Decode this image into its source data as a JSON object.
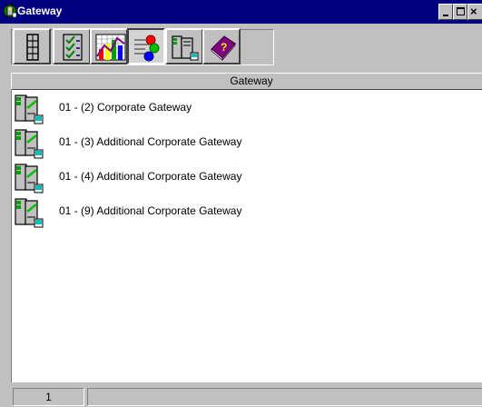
{
  "window": {
    "title": "Gateway",
    "icon": "gateway-app-icon",
    "controls": {
      "minimize": "minimize-icon",
      "maximize": "maximize-icon",
      "close": "close-icon"
    }
  },
  "toolbar": {
    "buttons": [
      {
        "name": "columns-view-button",
        "icon": "column-list-icon"
      },
      {
        "name": "checklist-button",
        "icon": "checklist-icon"
      },
      {
        "name": "chart-button",
        "icon": "bar-chart-icon"
      },
      {
        "name": "traffic-button",
        "icon": "traffic-flow-icon",
        "pressed": true
      },
      {
        "name": "gateway-device-button",
        "icon": "gateway-device-icon"
      },
      {
        "name": "help-book-button",
        "icon": "help-book-icon"
      }
    ]
  },
  "list": {
    "column_header": "Gateway",
    "items": [
      {
        "label": "01 - (2)  Corporate Gateway",
        "icon": "gateway-device-icon"
      },
      {
        "label": "01 - (3)  Additional Corporate Gateway",
        "icon": "gateway-device-icon"
      },
      {
        "label": "01 - (4)  Additional Corporate Gateway",
        "icon": "gateway-device-icon"
      },
      {
        "label": "01 - (9)  Additional Corporate Gateway",
        "icon": "gateway-device-icon"
      }
    ]
  },
  "statusbar": {
    "count": "1",
    "message": ""
  },
  "colors": {
    "titlebar": "#000080",
    "face": "#c0c0c0",
    "list_bg": "#ffffff"
  }
}
